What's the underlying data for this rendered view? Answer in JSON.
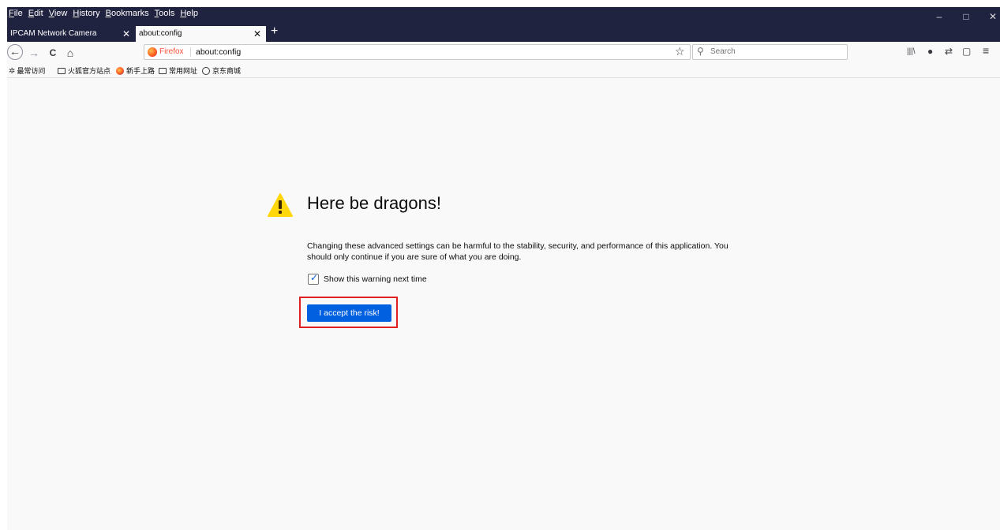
{
  "menu": [
    "File",
    "Edit",
    "View",
    "History",
    "Bookmarks",
    "Tools",
    "Help"
  ],
  "window_controls": {
    "minimize": "–",
    "maximize": "□",
    "close": "✕"
  },
  "tabs": [
    {
      "label": "IPCAM Network Camera",
      "active": false
    },
    {
      "label": "about:config",
      "active": true
    }
  ],
  "tab_close": "✕",
  "new_tab": "+",
  "nav": {
    "back": "←",
    "forward": "→",
    "reload": "C",
    "home": "⌂"
  },
  "urlbar": {
    "identity": "Firefox",
    "url": "about:config"
  },
  "bookmark_star": "☆",
  "search": {
    "placeholder": "Search",
    "icon": "⚲"
  },
  "toolbar_icons": {
    "library": "|||\\",
    "chat": "●",
    "sync": "⇄",
    "sidebar": "▢",
    "menu": "≡"
  },
  "bookmarks": [
    {
      "label": "最常访问",
      "icon": "gear"
    },
    {
      "label": "火狐官方站点",
      "icon": "folder"
    },
    {
      "label": "新手上路",
      "icon": "firefox"
    },
    {
      "label": "常用网址",
      "icon": "folder"
    },
    {
      "label": "京东商城",
      "icon": "globe"
    }
  ],
  "page": {
    "title": "Here be dragons!",
    "description": "Changing these advanced settings can be harmful to the stability, security, and performance of this application. You should only continue if you are sure of what you are doing.",
    "checkbox_label": "Show this warning next time",
    "checkbox_checked": true,
    "accept_button": "I accept the risk!"
  },
  "colors": {
    "accent": "#0060df",
    "warning": "#ffd70a",
    "highlight": "#e02020",
    "titlebar": "#202340"
  }
}
